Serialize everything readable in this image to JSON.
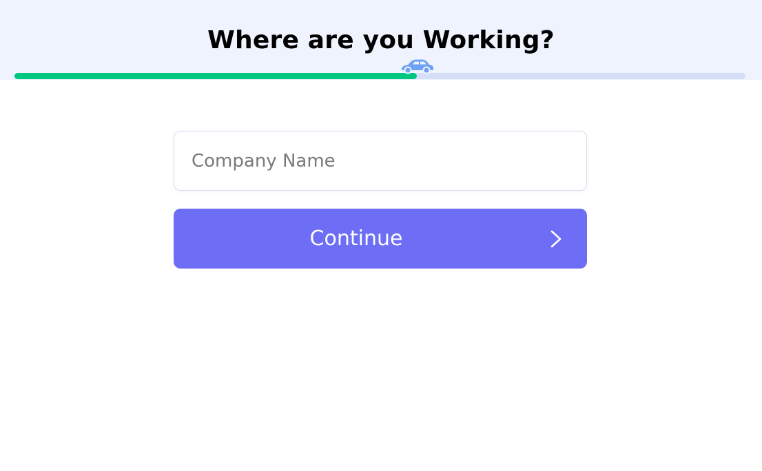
{
  "header": {
    "title": "Where are you Working?",
    "progress_fraction": 0.55,
    "progress_icon": "car-icon"
  },
  "form": {
    "company_placeholder": "Company Name",
    "company_value": "",
    "continue_label": "Continue",
    "continue_icon": "chevron-right-icon"
  },
  "colors": {
    "header_background": "#eef3fe",
    "progress_fill": "#00c77f",
    "progress_track": "#d6ddf6",
    "car": "#6ea2f5",
    "button": "#6d6df5",
    "input_border": "#dcdcf2"
  }
}
